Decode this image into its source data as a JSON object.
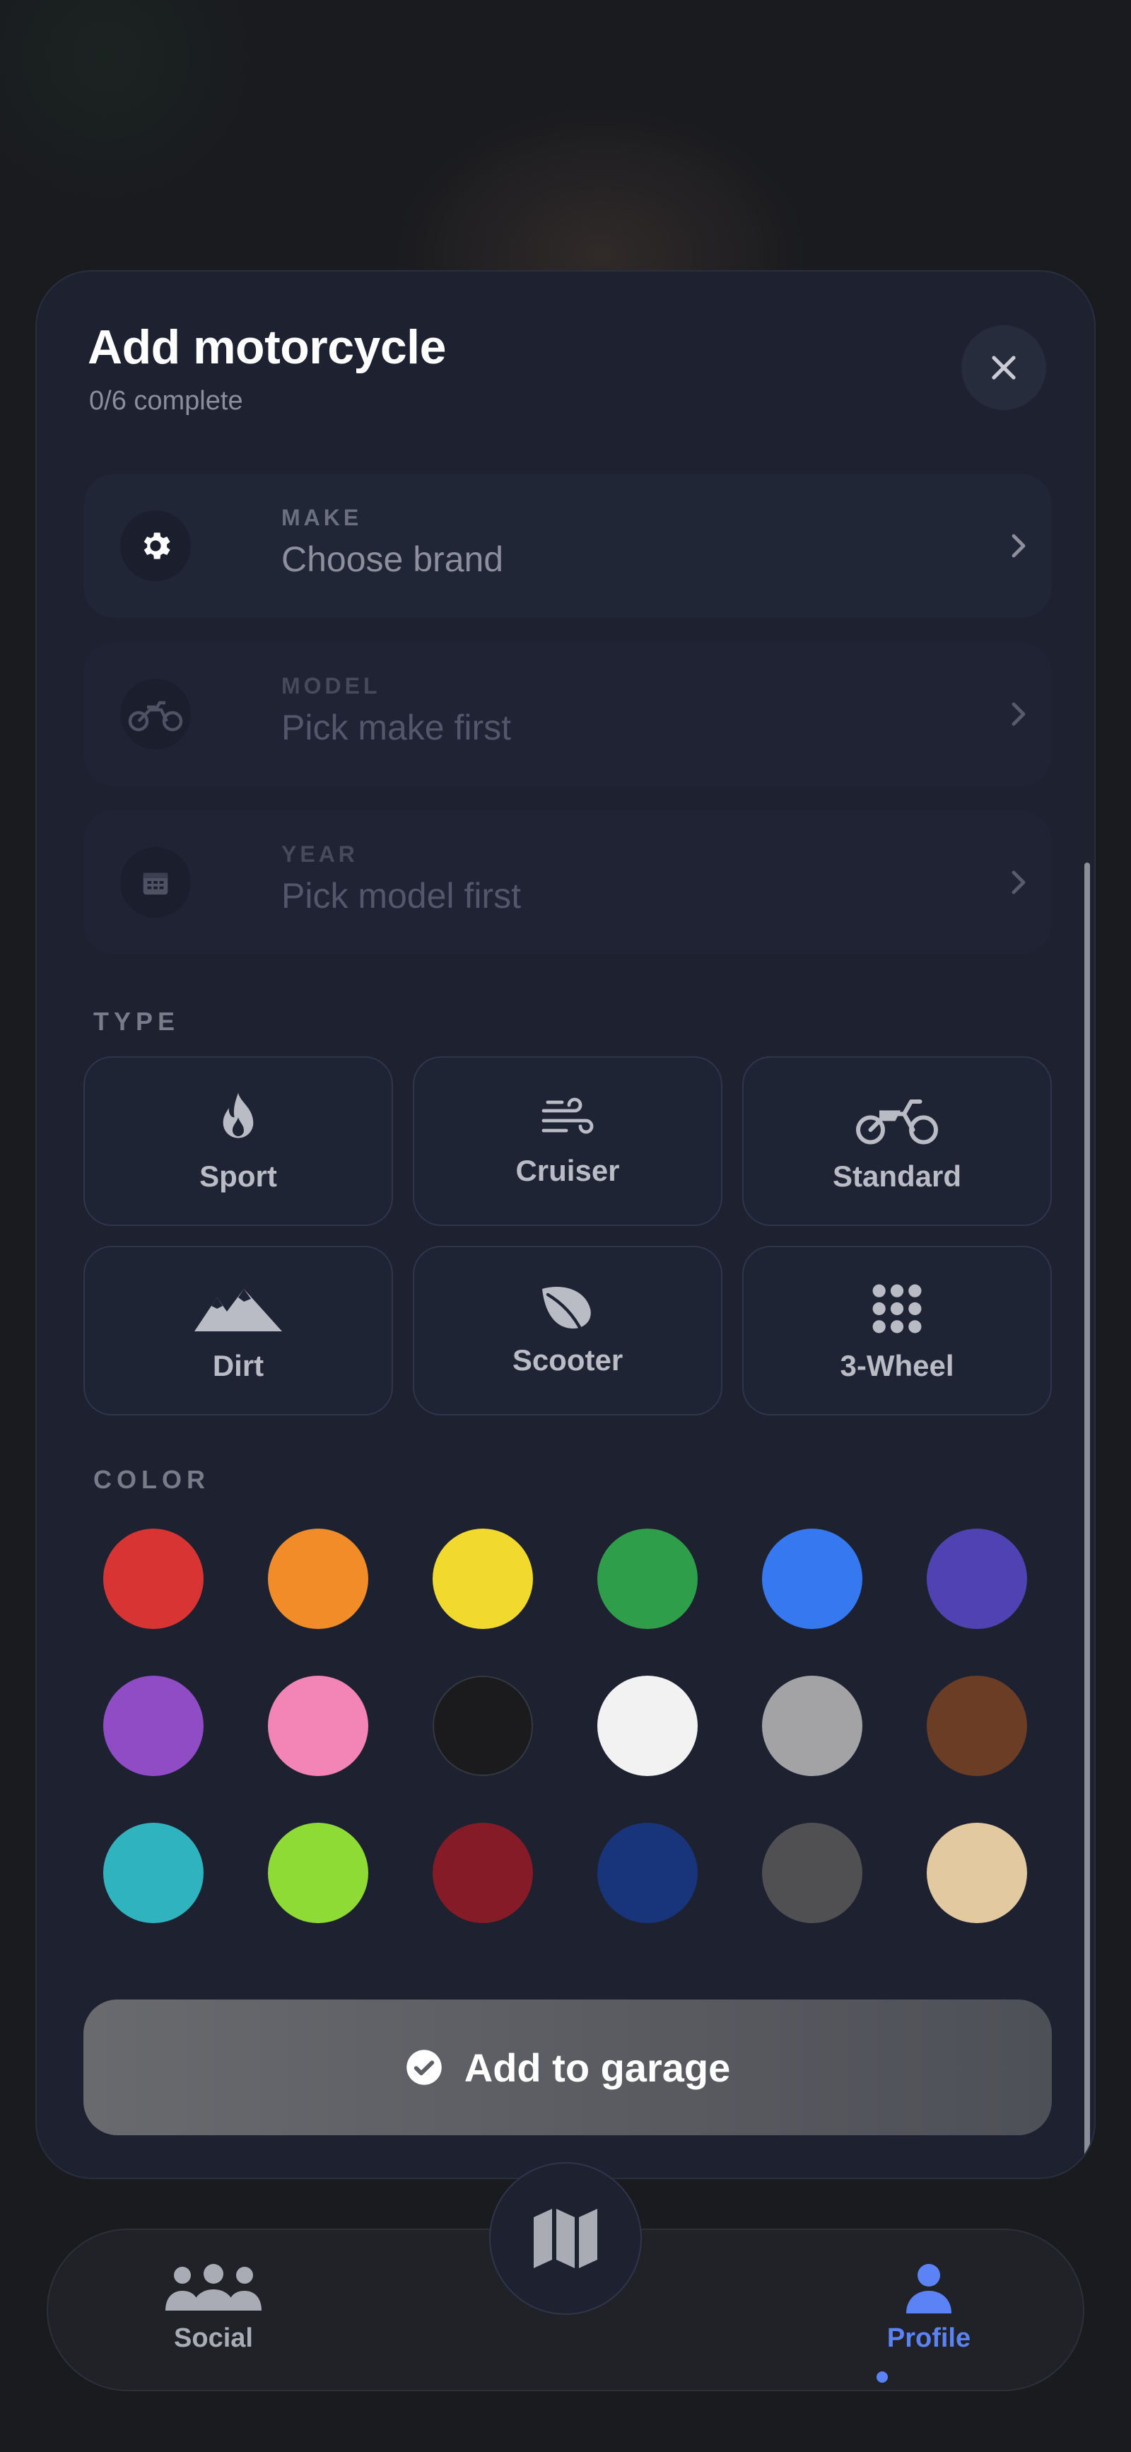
{
  "sheet": {
    "title": "Add motorcycle",
    "progress": "0/6 complete",
    "close_icon": "close-icon"
  },
  "pickers": [
    {
      "label": "MAKE",
      "value": "Choose brand",
      "icon": "gear-icon",
      "enabled": true
    },
    {
      "label": "MODEL",
      "value": "Pick make first",
      "icon": "motorcycle-icon",
      "enabled": false
    },
    {
      "label": "YEAR",
      "value": "Pick model first",
      "icon": "calendar-icon",
      "enabled": false
    }
  ],
  "type_section": {
    "label": "TYPE",
    "options": [
      {
        "label": "Sport",
        "icon": "flame-icon"
      },
      {
        "label": "Cruiser",
        "icon": "wind-icon"
      },
      {
        "label": "Standard",
        "icon": "motorcycle-icon"
      },
      {
        "label": "Dirt",
        "icon": "mountains-icon"
      },
      {
        "label": "Scooter",
        "icon": "leaf-icon"
      },
      {
        "label": "3-Wheel",
        "icon": "grid-dots-icon"
      }
    ]
  },
  "color_section": {
    "label": "COLOR",
    "swatches": [
      "#d93434",
      "#f28c28",
      "#f2d92e",
      "#2f9e4a",
      "#3578f0",
      "#5142b3",
      "#8f4cc4",
      "#f285b6",
      "#1b1b1d",
      "#f2f2f2",
      "#a3a3a5",
      "#6b3d25",
      "#2fb3bf",
      "#8fdb35",
      "#841b26",
      "#18347a",
      "#505052",
      "#e2c9a0"
    ]
  },
  "primary_action": {
    "label": "Add to garage",
    "icon": "check-circle-icon"
  },
  "bottom_nav": {
    "items": [
      {
        "label": "Social",
        "icon": "people-icon",
        "active": false
      },
      {
        "label": "Profile",
        "icon": "person-icon",
        "active": true
      }
    ],
    "center_icon": "map-icon"
  },
  "colors": {
    "accent": "#5b83f5",
    "sheet_bg": "#1d2130"
  }
}
